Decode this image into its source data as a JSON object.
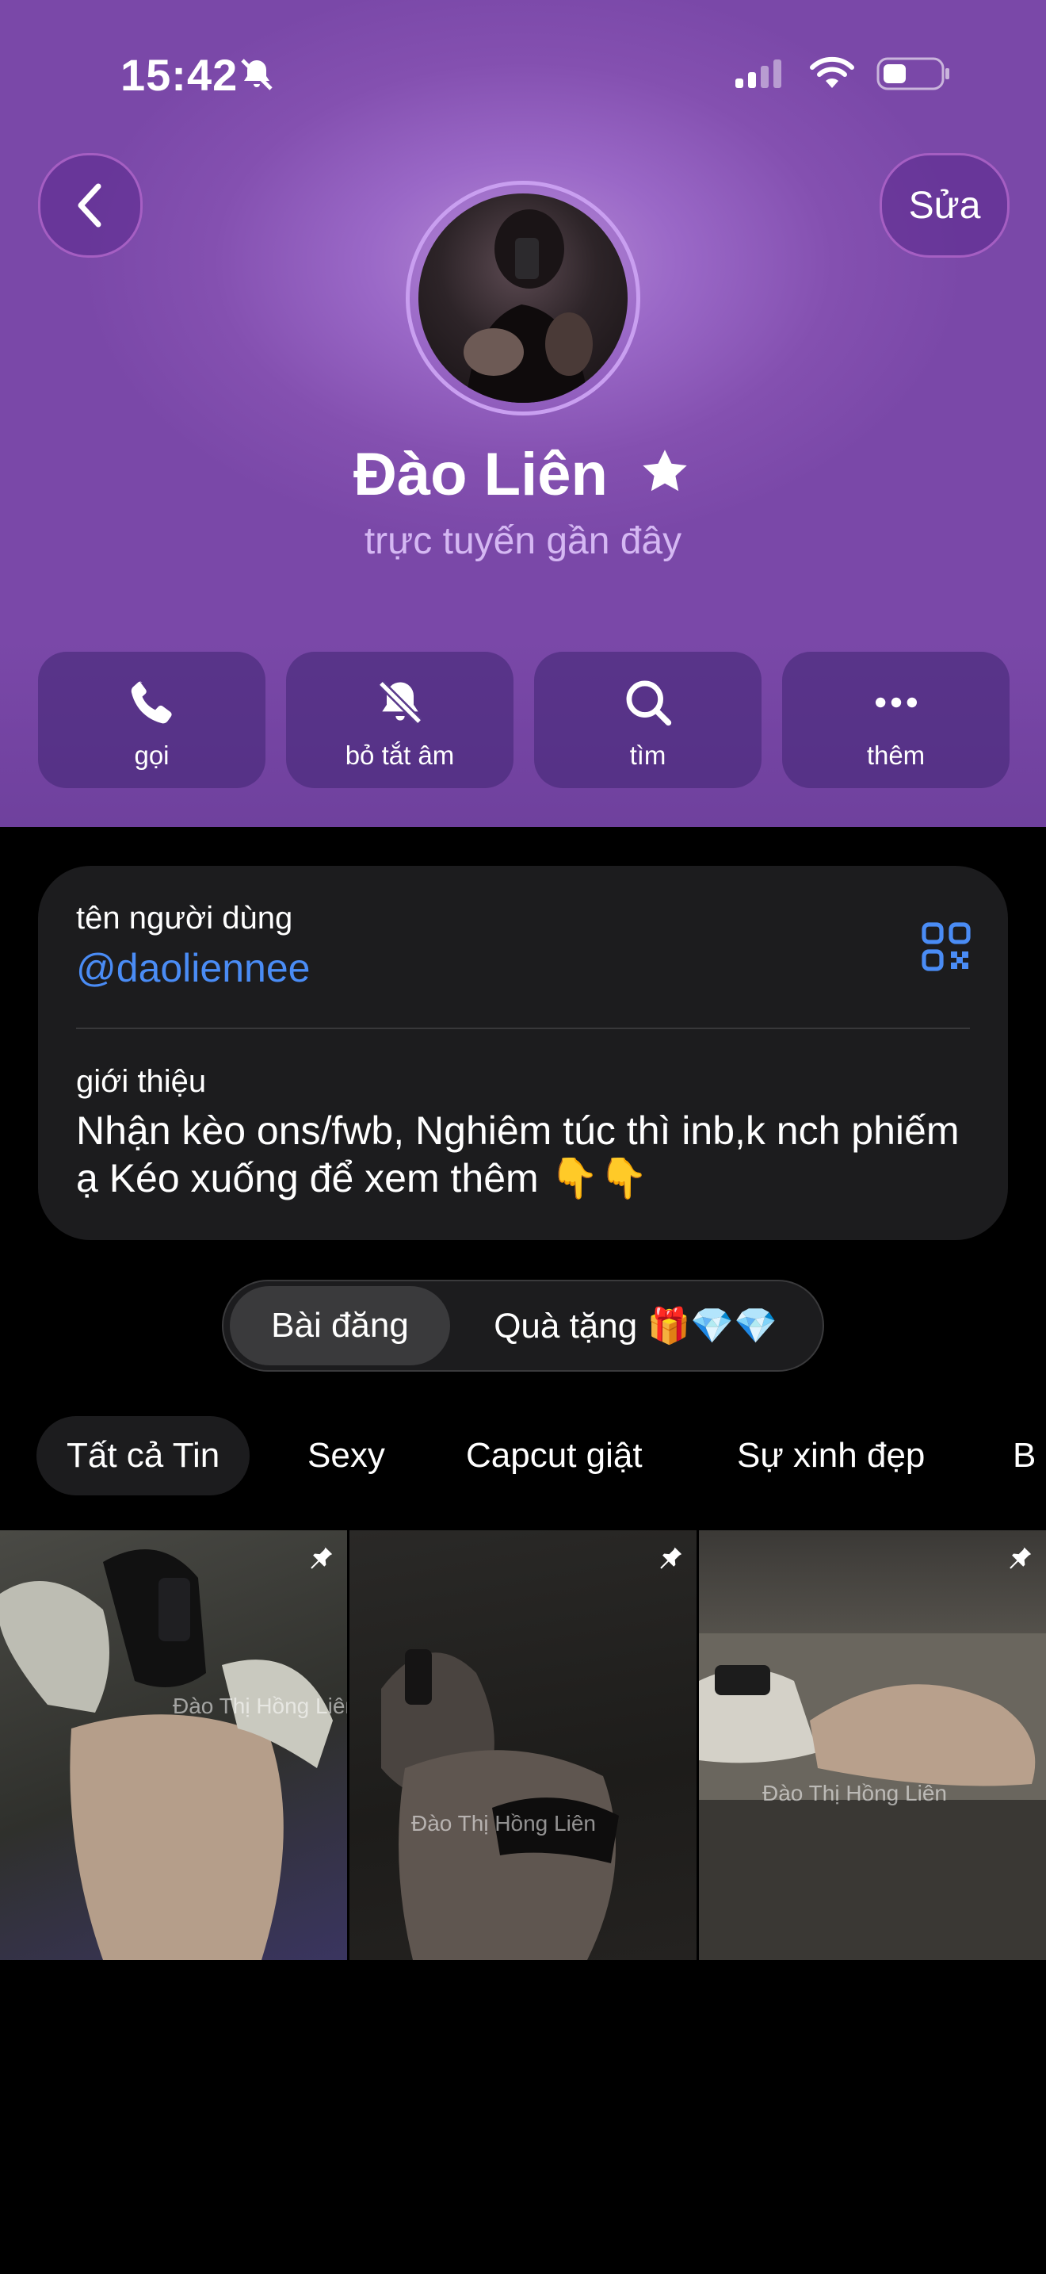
{
  "status_bar": {
    "time": "15:42"
  },
  "nav": {
    "edit_label": "Sửa"
  },
  "profile": {
    "name": "Đào Liên",
    "status": "trực tuyến gần đây"
  },
  "actions": [
    {
      "label": "gọi",
      "icon": "phone-icon"
    },
    {
      "label": "bỏ tắt âm",
      "icon": "bell-muted-icon"
    },
    {
      "label": "tìm",
      "icon": "search-icon"
    },
    {
      "label": "thêm",
      "icon": "more-icon"
    }
  ],
  "info": {
    "username_label": "tên người dùng",
    "username": "@daoliennee",
    "bio_label": "giới thiệu",
    "bio": "Nhận kèo ons/fwb, Nghiêm túc thì inb,k nch phiếm ạ Kéo xuống để xem thêm 👇👇"
  },
  "segments": [
    {
      "label": "Bài đăng"
    },
    {
      "label": "Quà tặng 🎁💎💎"
    }
  ],
  "story_categories": [
    {
      "label": "Tất cả Tin"
    },
    {
      "label": "Sexy"
    },
    {
      "label": "Capcut giật"
    },
    {
      "label": "Sự xinh đẹp"
    },
    {
      "label": "B"
    }
  ],
  "media_grid": [
    {
      "watermark": "Đào Thị Hồng Liên"
    },
    {
      "watermark": "Đào Thị Hồng Liên"
    },
    {
      "watermark": "Đào Thị Hồng Liên"
    }
  ],
  "colors": {
    "header_purple": "#8450b0",
    "link_blue": "#4a8cf5",
    "card_bg": "#1c1c1e"
  }
}
